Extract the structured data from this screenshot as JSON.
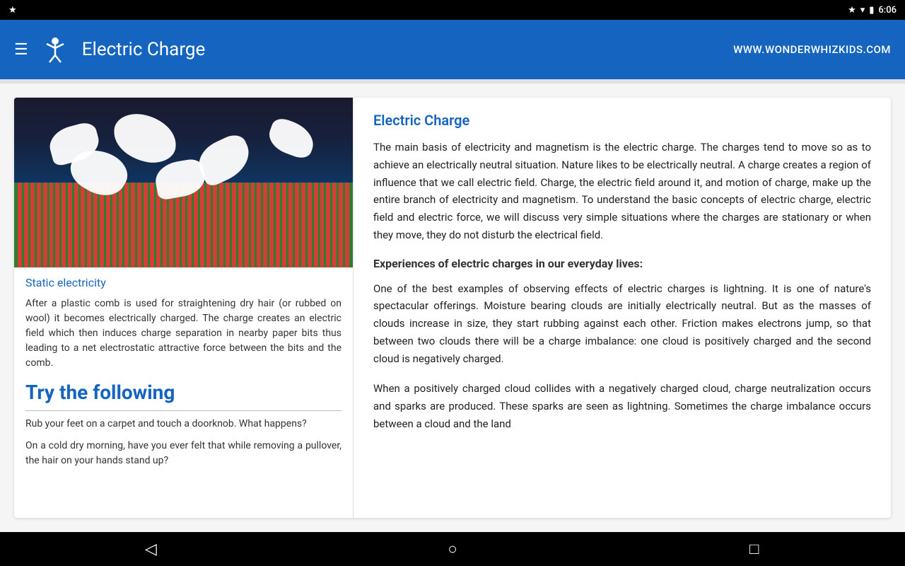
{
  "statusBar": {
    "leftIcon": "★",
    "wifiIcon": "▾",
    "batteryIcon": "🔋",
    "time": "6:06"
  },
  "appBar": {
    "title": "Electric Charge",
    "website": "WWW.WONDERWHIZKIDS.COM"
  },
  "leftPanel": {
    "imageAlt": "Static electricity - comb attracting paper bits",
    "captionTitle": "Static electricity",
    "captionText": "After a plastic comb is used for straightening dry hair (or rubbed on wool) it becomes electrically charged. The charge creates an electric field which then induces charge separation in nearby paper bits thus leading to a net electrostatic attractive force between the bits and the comb.",
    "tryHeading": "Try the following",
    "activity1": "Rub your feet on a carpet and touch a doorknob. What happens?",
    "activity2": "On a cold dry morning, have you ever felt that while removing a pullover, the hair on your hands stand up?"
  },
  "rightPanel": {
    "articleTitle": "Electric Charge",
    "articleBody": "The main basis of electricity and magnetism is the electric charge. The charges tend to move so as to achieve an electrically neutral situation. Nature likes to be electrically neutral. A charge creates a region of influence that we call electric field. Charge, the electric field around it, and motion of charge, make up the entire branch of electricity and magnetism. To understand the basic concepts of electric charge, electric field and electric force, we will discuss very simple situations where the charges are stationary or when they move, they do not disturb the electrical field.",
    "sectionHeading": "Experiences of electric charges in our everyday lives:",
    "section1": "One of the best examples of observing effects of electric charges is lightning. It is one of nature's spectacular offerings. Moisture bearing clouds are initially electrically neutral. But as the masses of clouds increase in size, they start rubbing against each other. Friction makes electrons jump, so that between two clouds there will be a charge imbalance: one cloud is positively charged and the second cloud is negatively charged.",
    "section2": "When a positively charged cloud collides with a negatively charged cloud, charge neutralization occurs and sparks are produced. These sparks are seen as lightning. Sometimes the charge imbalance occurs between a cloud and the land"
  },
  "navBar": {
    "backIcon": "◁",
    "homeIcon": "○",
    "recentIcon": "□"
  }
}
